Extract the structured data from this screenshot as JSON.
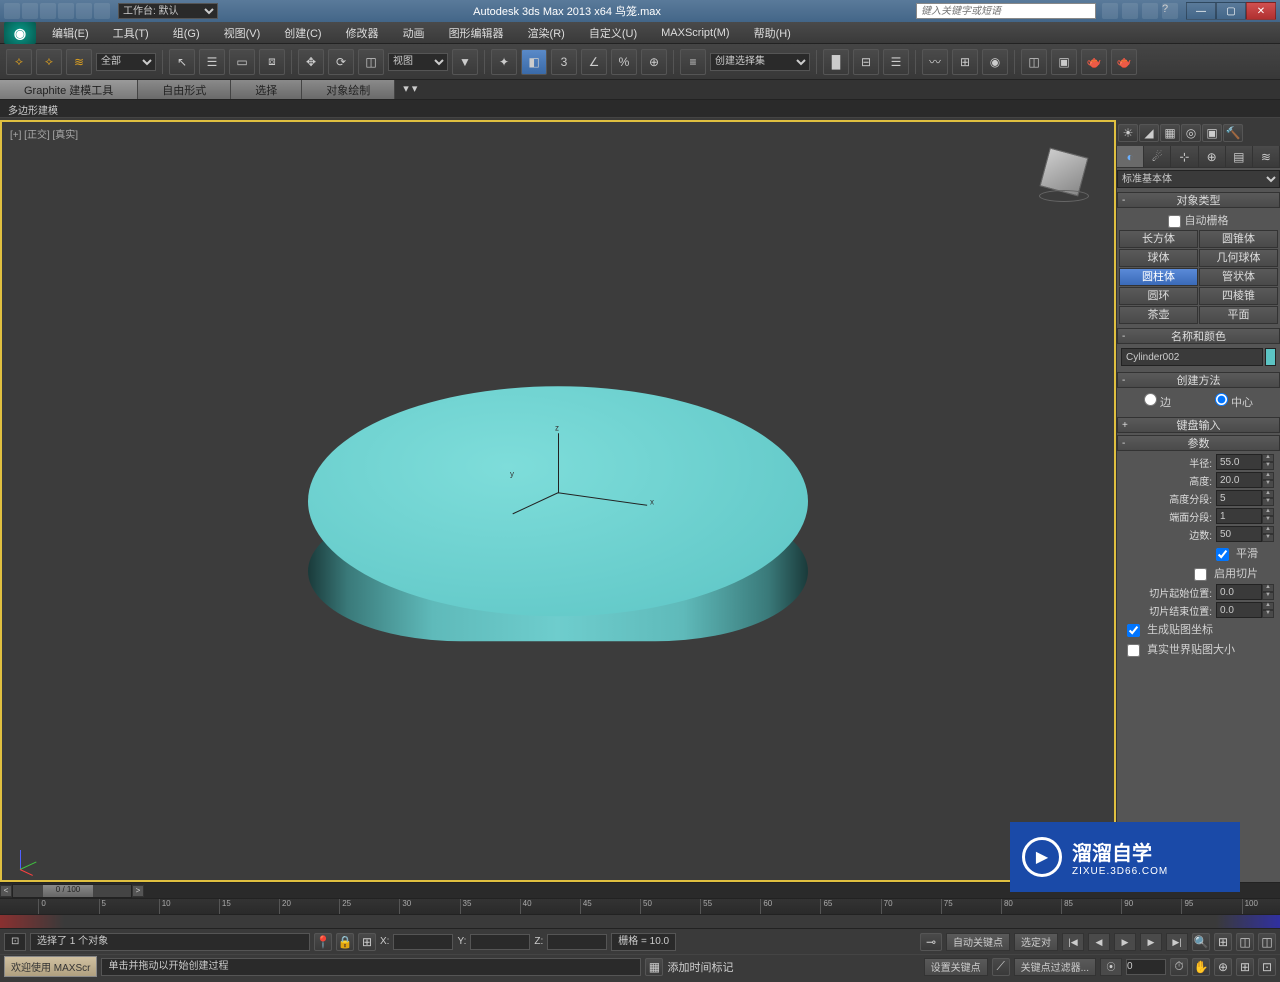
{
  "titlebar": {
    "workspace_label": "工作台: 默认",
    "title": "Autodesk 3ds Max  2013 x64    鸟笼.max",
    "search_placeholder": "键入关键字或短语"
  },
  "menu": [
    "编辑(E)",
    "工具(T)",
    "组(G)",
    "视图(V)",
    "创建(C)",
    "修改器",
    "动画",
    "图形编辑器",
    "渲染(R)",
    "自定义(U)",
    "MAXScript(M)",
    "帮助(H)"
  ],
  "toolbar": {
    "filter": "全部",
    "view": "视图",
    "named_set": "创建选择集"
  },
  "ribbon": {
    "tabs": [
      "Graphite 建模工具",
      "自由形式",
      "选择",
      "对象绘制"
    ],
    "sub": "多边形建模"
  },
  "viewport": {
    "label": "[+] [正交] [真实]",
    "axes": {
      "x": "x",
      "y": "y",
      "z": "z"
    }
  },
  "panel": {
    "dropdown": "标准基本体",
    "rollouts": {
      "obj_type_header": "对象类型",
      "auto_grid": "自动栅格",
      "primitives_left": [
        "长方体",
        "球体",
        "圆柱体",
        "圆环",
        "茶壶"
      ],
      "primitives_right": [
        "圆锥体",
        "几何球体",
        "管状体",
        "四棱锥",
        "平面"
      ],
      "name_color_header": "名称和颜色",
      "object_name": "Cylinder002",
      "creation_header": "创建方法",
      "creation_edge": "边",
      "creation_center": "中心",
      "keyboard_header": "键盘输入",
      "params_header": "参数",
      "params": {
        "radius_label": "半径:",
        "radius_val": "55.0",
        "height_label": "高度:",
        "height_val": "20.0",
        "height_seg_label": "高度分段:",
        "height_seg_val": "5",
        "cap_seg_label": "端面分段:",
        "cap_seg_val": "1",
        "sides_label": "边数:",
        "sides_val": "50",
        "smooth": "平滑",
        "slice_on": "启用切片",
        "slice_from_label": "切片起始位置:",
        "slice_from_val": "0.0",
        "slice_to_label": "切片结束位置:",
        "slice_to_val": "0.0",
        "gen_uv": "生成贴图坐标",
        "real_world": "真实世界贴图大小"
      }
    }
  },
  "timeline": {
    "slider_text": "0 / 100",
    "ticks": [
      "0",
      "5",
      "10",
      "15",
      "20",
      "25",
      "30",
      "35",
      "40",
      "45",
      "50",
      "55",
      "60",
      "65",
      "70",
      "75",
      "80",
      "85",
      "90",
      "95",
      "100"
    ]
  },
  "status": {
    "selected_msg": "选择了 1 个对象",
    "prompt_msg": "单击并拖动以开始创建过程",
    "x_label": "X:",
    "y_label": "Y:",
    "z_label": "Z:",
    "grid_label": "栅格 = 10.0",
    "auto_key": "自动关键点",
    "set_key": "设置关键点",
    "selected_set": "选定对",
    "key_filters": "关键点过滤器...",
    "add_time_tag": "添加时间标记",
    "welcome": "欢迎使用  MAXScr",
    "frame": "0"
  },
  "watermark": {
    "big": "溜溜自学",
    "small": "ZIXUE.3D66.COM"
  }
}
